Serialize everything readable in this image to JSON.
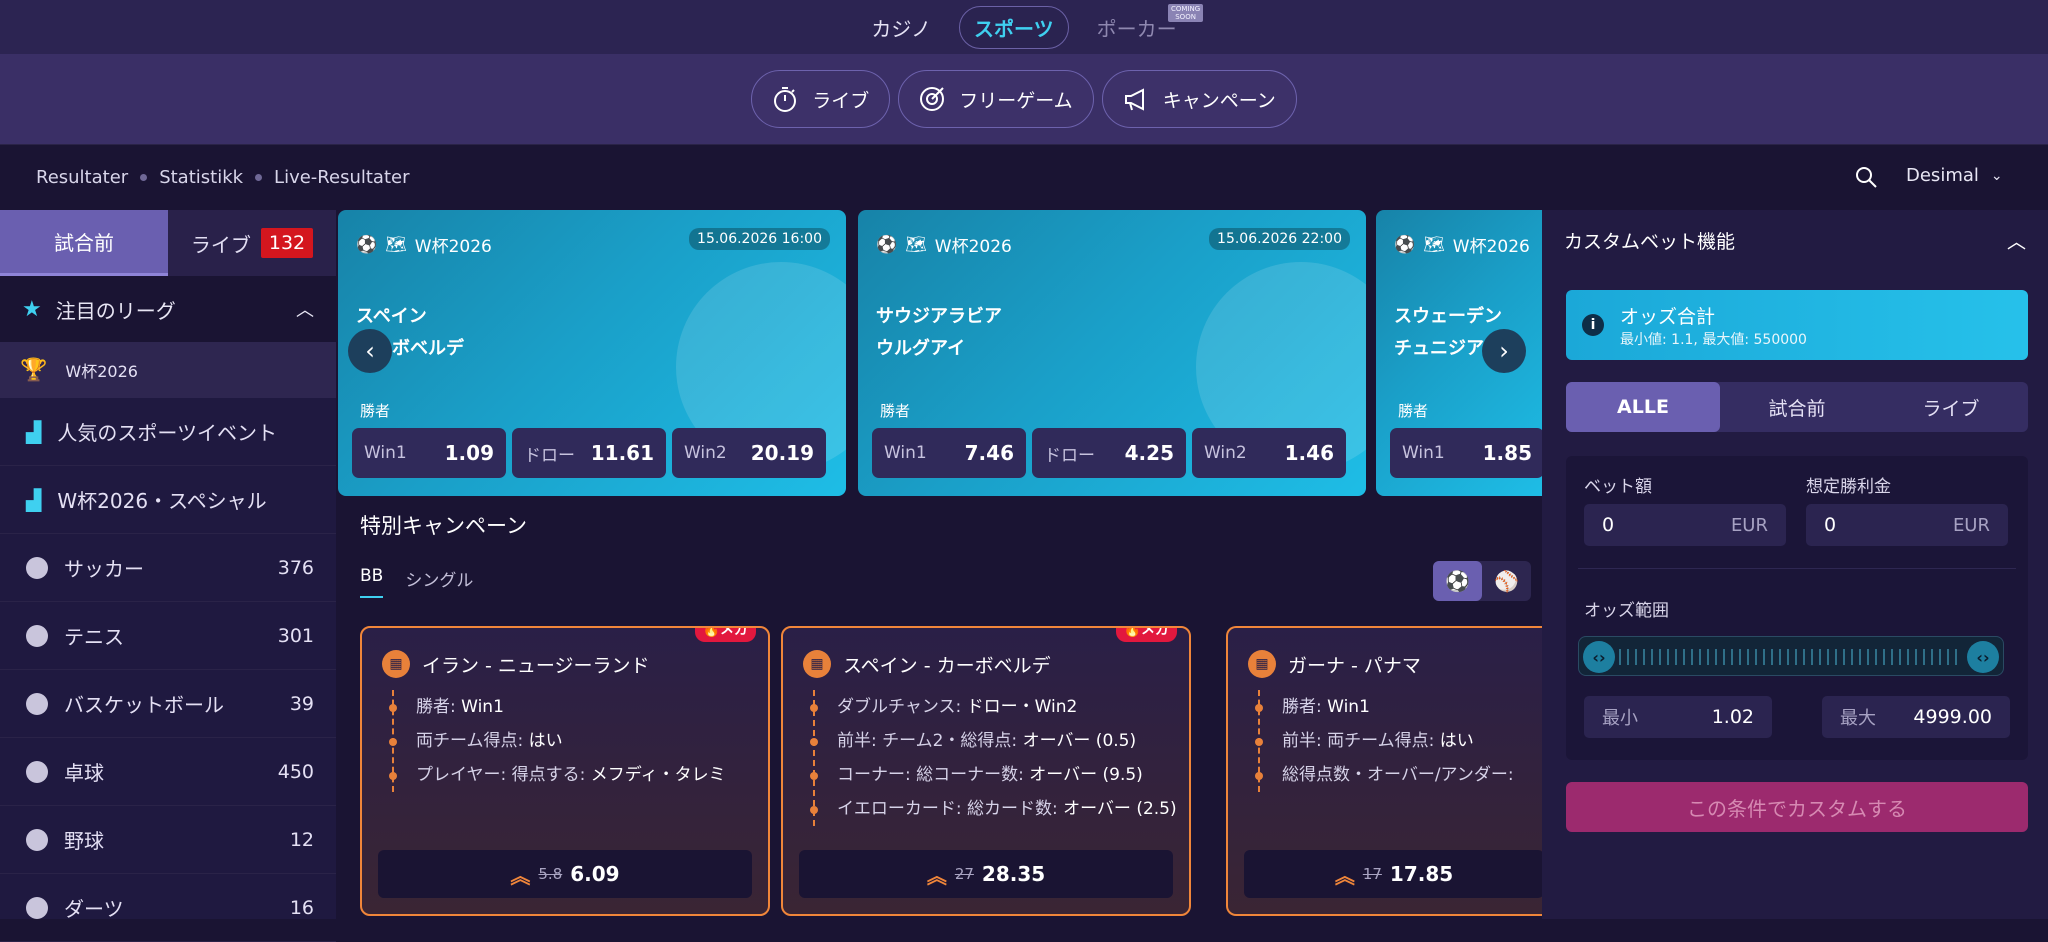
{
  "topnav": {
    "casino": "カジノ",
    "sports": "スポーツ",
    "poker": "ポーカー",
    "coming_soon_1": "COMING",
    "coming_soon_2": "SOON"
  },
  "pills": {
    "live": "ライブ",
    "free_game": "フリーゲーム",
    "campaign": "キャンペーン"
  },
  "subnav": {
    "results": "Resultater",
    "statistics": "Statistikk",
    "live_results": "Live-Resultater",
    "odds_format": "Desimal"
  },
  "sidebar": {
    "tab_prematch": "試合前",
    "tab_live": "ライブ",
    "live_count": "132",
    "featured_header": "注目のリーグ",
    "league": "W杯2026",
    "items": [
      {
        "label": "人気のスポーツイベント",
        "count": ""
      },
      {
        "label": "W杯2026・スペシャル",
        "count": ""
      },
      {
        "label": "サッカー",
        "count": "376"
      },
      {
        "label": "テニス",
        "count": "301"
      },
      {
        "label": "バスケットボール",
        "count": "39"
      },
      {
        "label": "卓球",
        "count": "450"
      },
      {
        "label": "野球",
        "count": "12"
      },
      {
        "label": "ダーツ",
        "count": "16"
      }
    ]
  },
  "matches": [
    {
      "league": "W杯2026",
      "date": "15.06.2026 16:00",
      "team1": "スペイン",
      "team2": "カーボベルデ",
      "market": "勝者",
      "odds": [
        {
          "label": "Win1",
          "value": "1.09"
        },
        {
          "label": "ドロー",
          "value": "11.61"
        },
        {
          "label": "Win2",
          "value": "20.19"
        }
      ]
    },
    {
      "league": "W杯2026",
      "date": "15.06.2026 22:00",
      "team1": "サウジアラビア",
      "team2": "ウルグアイ",
      "market": "勝者",
      "odds": [
        {
          "label": "Win1",
          "value": "7.46"
        },
        {
          "label": "ドロー",
          "value": "4.25"
        },
        {
          "label": "Win2",
          "value": "1.46"
        }
      ]
    },
    {
      "league": "W杯2026",
      "date": "",
      "team1": "スウェーデン",
      "team2": "チュニジア",
      "market": "勝者",
      "odds": [
        {
          "label": "Win1",
          "value": "1.85"
        }
      ]
    }
  ],
  "campaign": {
    "title": "特別キャンペーン",
    "tab_bb": "BB",
    "tab_single": "シングル",
    "cards": [
      {
        "badge": "メガ",
        "match": "イラン - ニュージーランド",
        "lines": [
          {
            "k": "勝者: ",
            "v": "Win1"
          },
          {
            "k": "両チーム得点: ",
            "v": "はい"
          },
          {
            "k": "プレイヤー: 得点する: ",
            "v": "メフディ・タレミ"
          }
        ],
        "old_odds": "5.8",
        "new_odds": "6.09"
      },
      {
        "badge": "メガ",
        "match": "スペイン - カーボベルデ",
        "lines": [
          {
            "k": "ダブルチャンス: ",
            "v": "ドロー・Win2"
          },
          {
            "k": "前半: チーム2・総得点: ",
            "v": "オーバー (0.5)"
          },
          {
            "k": "コーナー: 総コーナー数: ",
            "v": "オーバー (9.5)"
          },
          {
            "k": "イエローカード: 総カード数: ",
            "v": "オーバー (2.5)"
          }
        ],
        "old_odds": "27",
        "new_odds": "28.35"
      },
      {
        "badge": "",
        "match": "ガーナ - パナマ",
        "lines": [
          {
            "k": "勝者: ",
            "v": "Win1"
          },
          {
            "k": "前半: 両チーム得点: ",
            "v": "はい"
          },
          {
            "k": "総得点数・オーバー/アンダー: ",
            "v": ""
          }
        ],
        "old_odds": "17",
        "new_odds": "17.85"
      }
    ]
  },
  "custom_bet": {
    "title": "カスタムベット機能",
    "info_title": "オッズ合計",
    "info_sub": "最小値: 1.1, 最大値: 550000",
    "tab_all": "ALLE",
    "tab_prematch": "試合前",
    "tab_live": "ライブ",
    "stake_label": "ベット額",
    "payout_label": "想定勝利金",
    "stake_value": "0",
    "payout_value": "0",
    "currency": "EUR",
    "range_label": "オッズ範囲",
    "min_label": "最小",
    "min_value": "1.02",
    "max_label": "最大",
    "max_value": "4999.00",
    "cta": "この条件でカスタムする"
  }
}
